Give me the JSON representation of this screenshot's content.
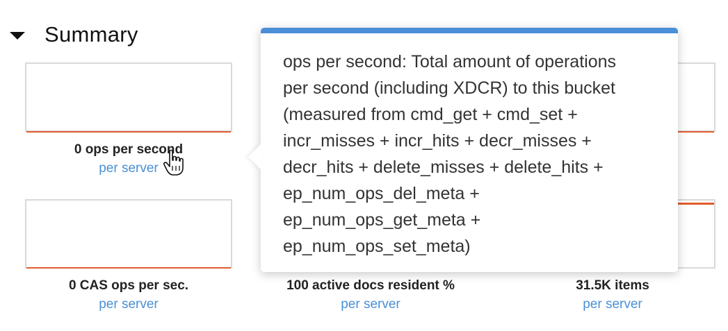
{
  "summary": {
    "title": "Summary"
  },
  "graphs": [
    {
      "label": "0 ops per second",
      "sub": "per server"
    },
    {
      "label": "0 CAS ops per sec.",
      "sub": "per server"
    },
    {
      "label": "100 active docs resident %",
      "sub": "per server"
    },
    {
      "label": "31.5K items",
      "sub": "per server"
    }
  ],
  "tooltip": {
    "text": "ops per second: Total amount of operations\nper second (including XDCR) to this bucket\n(measured from cmd_get + cmd_set +\nincr_misses + incr_hits + decr_misses +\ndecr_hits + delete_misses + delete_hits +\nep_num_ops_del_meta +\nep_num_ops_get_meta +\nep_num_ops_set_meta)"
  },
  "colors": {
    "accent": "#4a8fd8",
    "series_line": "#e25a2c",
    "link": "#4a90d6"
  },
  "icons": {
    "collapse": "caret-down-icon",
    "pointer": "hand-pointer-icon"
  }
}
